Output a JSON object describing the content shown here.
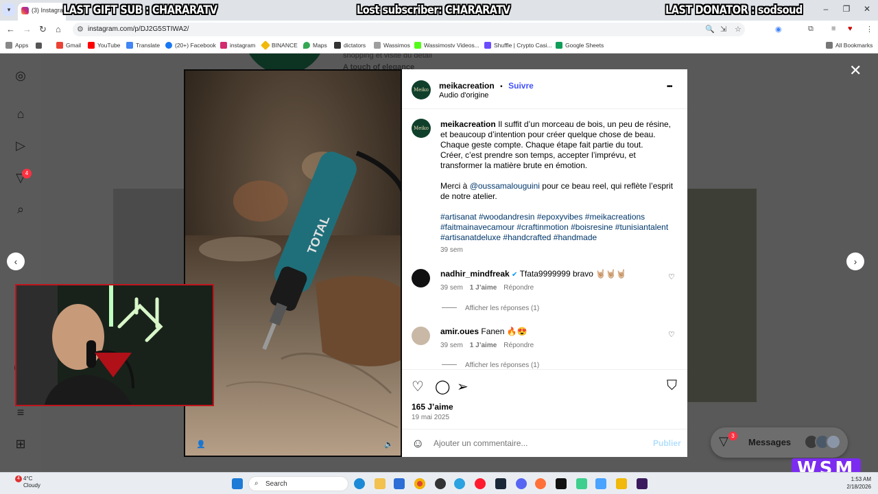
{
  "browser": {
    "tab_title": "(3) Instagram",
    "url": "instagram.com/p/DJ2G5STIWA2/",
    "bookmarks": [
      "Apps",
      "Gmail",
      "YouTube",
      "Translate",
      "(20+) Facebook",
      "instagram",
      "BINANCE",
      "Maps",
      "dictators",
      "Wassimos",
      "Wassimostv Videos...",
      "Shuffle | Crypto Casi...",
      "Google Sheets"
    ],
    "all_bookmarks": "All Bookmarks"
  },
  "stream_overlay": {
    "last_gift": "LAST GIFT SUB : CHARARATV",
    "lost_sub": "Lost subscriber: CHARARATV",
    "last_donator": "LAST DONATOR : sodsoud",
    "logo_text": "WSM"
  },
  "background": {
    "text1": "shopping et visite du détail",
    "text2": "A touch of elegance"
  },
  "sidebar": {
    "notification_count": "4"
  },
  "post": {
    "avatar_text": "Meiko",
    "username": "meikacreation",
    "follow": "Suivre",
    "dot": "•",
    "audio": "Audio d'origine",
    "more": "•••",
    "caption_user": "meikacreation",
    "caption_p1": "Il suffit d’un morceau de bois, un peu de résine, et beaucoup d’intention pour créer quelque chose de beau.",
    "caption_p2": "Chaque geste compte. Chaque étape fait partie du tout.",
    "caption_p3": "Créer, c’est prendre son temps, accepter l’imprévu, et transformer la matière brute en émotion.",
    "thanks_prefix": "Merci à ",
    "thanks_mention": "@oussamalouguini",
    "thanks_suffix": " pour ce beau reel, qui reflète l’esprit de notre atelier.",
    "hashtags": "#artisanat #woodandresin #epoxyvibes #meikacreations #faitmainavecamour #craftinmotion #boisresine #tunisiantalent #artisanatdeluxe #handcrafted #handmade",
    "caption_time": "39 sem",
    "likes": "165 J’aime",
    "date": "19 mai 2025",
    "comment_placeholder": "Ajouter un commentaire...",
    "publish": "Publier"
  },
  "comments": [
    {
      "user": "nadhir_mindfreak",
      "verified": "✔",
      "text": "Tfata9999999 bravo 🤘🏼🤘🏼🤘🏼",
      "time": "39 sem",
      "likes": "1 J’aime",
      "reply": "Répondre",
      "replies": "Afficher les réponses (1)"
    },
    {
      "user": "amir.oues",
      "verified": "",
      "text": "Fanen 🔥😍",
      "time": "39 sem",
      "likes": "1 J’aime",
      "reply": "Répondre",
      "replies": "Afficher les réponses (1)"
    }
  ],
  "messages": {
    "label": "Messages",
    "badge": "3"
  },
  "video_overlay_text": "TOTAL",
  "taskbar": {
    "temp": "4°C",
    "weather": "Cloudy",
    "weather_badge": "4",
    "search": "Search",
    "time": "1:53 AM",
    "date": "2/18/2026"
  },
  "colors": {
    "accent_blue": "#4150f7",
    "link_blue": "#00376b",
    "badge_red": "#ff3040",
    "publish_disabled": "#b2dffc"
  }
}
